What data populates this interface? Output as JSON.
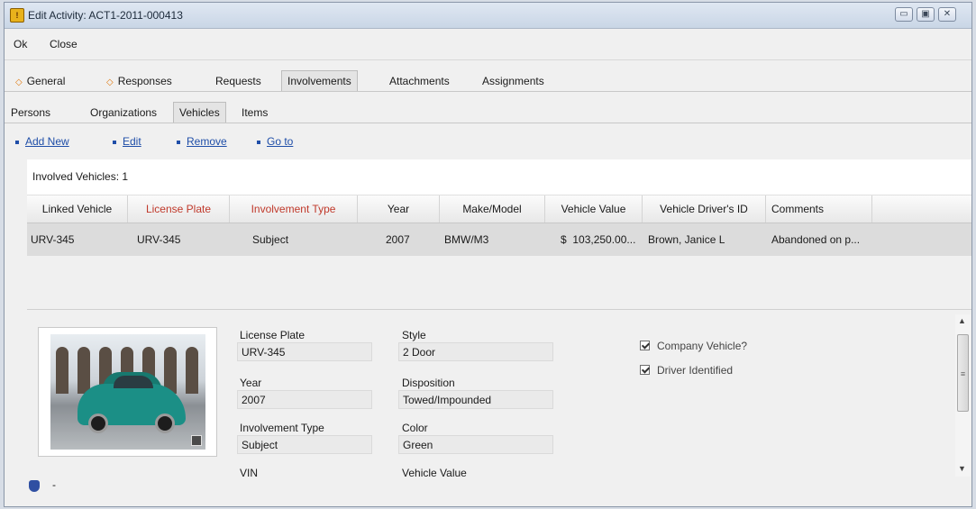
{
  "window": {
    "title": "Edit Activity: ACT1-2011-000413",
    "app_icon_glyph": "!",
    "controls": {
      "minimize": "▭",
      "restore": "▣",
      "close": "✕"
    }
  },
  "menu": {
    "ok": "Ok",
    "close": "Close"
  },
  "tabs": [
    {
      "label": "General",
      "marked": true
    },
    {
      "label": "Responses",
      "marked": true
    },
    {
      "label": "Requests",
      "marked": false
    },
    {
      "label": "Involvements",
      "marked": false,
      "active": true
    },
    {
      "label": "Attachments",
      "marked": false
    },
    {
      "label": "Assignments",
      "marked": false
    }
  ],
  "tab_marker": "◇",
  "subtabs": [
    {
      "label": "Persons"
    },
    {
      "label": "Organizations"
    },
    {
      "label": "Vehicles",
      "active": true
    },
    {
      "label": "Items"
    }
  ],
  "actions": {
    "add_new": "Add New",
    "edit": "Edit",
    "remove": "Remove",
    "go_to": "Go to"
  },
  "summary": "Involved Vehicles: 1",
  "grid": {
    "columns": [
      "Linked Vehicle",
      "License Plate",
      "Involvement Type",
      "Year",
      "Make/Model",
      "Vehicle Value",
      "Vehicle Driver's ID",
      "Comments"
    ],
    "rows": [
      [
        "URV-345",
        "URV-345",
        "Subject",
        "2007",
        "BMW/M3",
        "$  103,250.00...",
        "Brown, Janice L",
        "Abandoned on p..."
      ]
    ]
  },
  "detail": {
    "license_plate": {
      "label": "License Plate",
      "value": "URV-345"
    },
    "style": {
      "label": "Style",
      "value": "2 Door"
    },
    "year": {
      "label": "Year",
      "value": "2007"
    },
    "disposition": {
      "label": "Disposition",
      "value": "Towed/Impounded"
    },
    "involvement_type": {
      "label": "Involvement Type",
      "value": "Subject"
    },
    "color": {
      "label": "Color",
      "value": "Green"
    },
    "vin": {
      "label": "VIN"
    },
    "vehicle_value": {
      "label": "Vehicle Value"
    },
    "company_vehicle": {
      "label": "Company Vehicle?",
      "checked": true
    },
    "driver_identified": {
      "label": "Driver Identified",
      "checked": true
    },
    "status_text": "-"
  },
  "colors": {
    "required_header": "#c0392b",
    "link": "#1f4ea8",
    "marker": "#e07a10"
  }
}
